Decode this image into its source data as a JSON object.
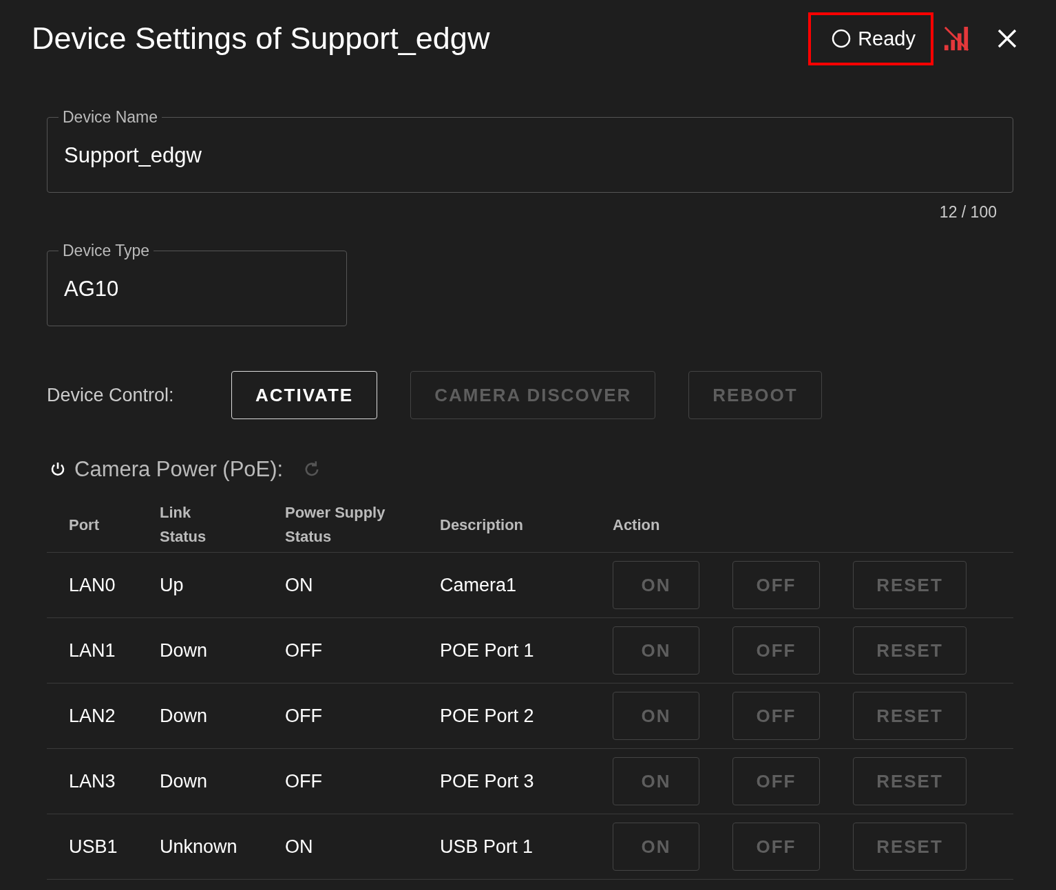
{
  "dialog": {
    "title": "Device Settings of Support_edgw",
    "status": {
      "label": "Ready",
      "highlighted": true
    },
    "signal": {
      "connected": false
    }
  },
  "device_name": {
    "label": "Device Name",
    "value": "Support_edgw",
    "counter": "12 / 100"
  },
  "device_type": {
    "label": "Device Type",
    "value": "AG10"
  },
  "device_control": {
    "label": "Device Control:",
    "buttons": [
      {
        "label": "ACTIVATE",
        "disabled": false
      },
      {
        "label": "CAMERA DISCOVER",
        "disabled": true
      },
      {
        "label": "REBOOT",
        "disabled": true
      }
    ]
  },
  "camera_power": {
    "title": "Camera Power (PoE):",
    "refresh_disabled": true,
    "columns": [
      "Port",
      "Link Status",
      "Power Supply Status",
      "Description",
      "Action"
    ],
    "rows": [
      {
        "port": "LAN0",
        "link": "Up",
        "power": "ON",
        "description": "Camera1",
        "actions": [
          {
            "label": "ON",
            "disabled": true
          },
          {
            "label": "OFF",
            "disabled": true
          },
          {
            "label": "RESET",
            "disabled": true
          }
        ]
      },
      {
        "port": "LAN1",
        "link": "Down",
        "power": "OFF",
        "description": "POE Port 1",
        "actions": [
          {
            "label": "ON",
            "disabled": true
          },
          {
            "label": "OFF",
            "disabled": true
          },
          {
            "label": "RESET",
            "disabled": true
          }
        ]
      },
      {
        "port": "LAN2",
        "link": "Down",
        "power": "OFF",
        "description": "POE Port 2",
        "actions": [
          {
            "label": "ON",
            "disabled": true
          },
          {
            "label": "OFF",
            "disabled": true
          },
          {
            "label": "RESET",
            "disabled": true
          }
        ]
      },
      {
        "port": "LAN3",
        "link": "Down",
        "power": "OFF",
        "description": "POE Port 3",
        "actions": [
          {
            "label": "ON",
            "disabled": true
          },
          {
            "label": "OFF",
            "disabled": true
          },
          {
            "label": "RESET",
            "disabled": true
          }
        ]
      },
      {
        "port": "USB1",
        "link": "Unknown",
        "power": "ON",
        "description": "USB Port 1",
        "actions": [
          {
            "label": "ON",
            "disabled": true
          },
          {
            "label": "OFF",
            "disabled": true
          },
          {
            "label": "RESET",
            "disabled": true
          }
        ]
      }
    ]
  }
}
